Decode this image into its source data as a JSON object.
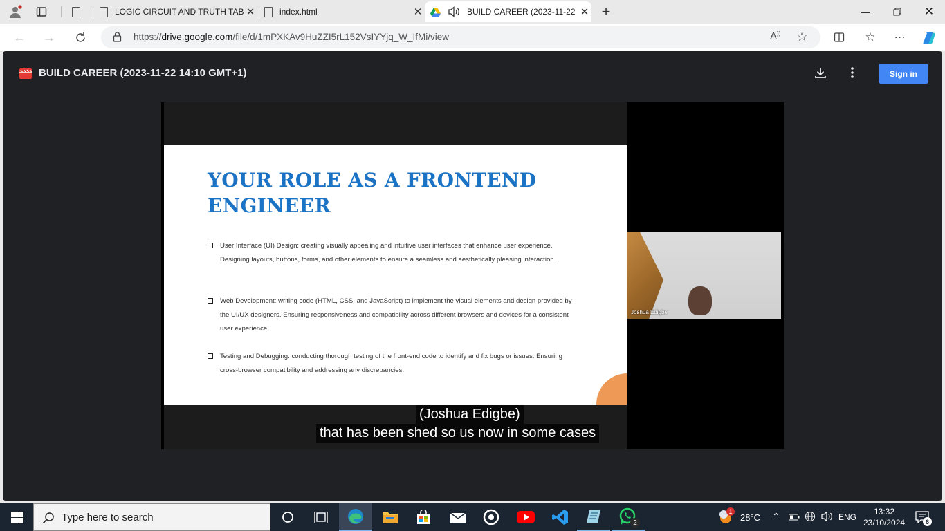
{
  "browser": {
    "tabs": [
      {
        "label": "LOGIC CIRCUIT AND TRUTH TABL"
      },
      {
        "label": "index.html"
      },
      {
        "label": "BUILD CAREER (2023-11-22"
      }
    ],
    "url_prefix": "https://",
    "url_domain": "drive.google.com",
    "url_path": "/file/d/1mPXKAv9HuZZI5rL152VsIYYjq_W_IfMi/view"
  },
  "viewer": {
    "title": "BUILD CAREER (2023-11-22 14:10 GMT+1)",
    "sign_in_label": "Sign in"
  },
  "slide": {
    "title": "YOUR ROLE AS A FRONTEND ENGINEER",
    "bullets": [
      {
        "text": "User Interface (UI) Design: creating visually appealing and intuitive user interfaces that enhance user experience. Designing layouts, buttons, forms, and other elements to ensure a seamless and aesthetically pleasing interaction."
      },
      {
        "text": "Web Development: writing code (HTML, CSS, and JavaScript) to implement the visual elements and design provided by the UI/UX designers. Ensuring responsiveness and compatibility across different browsers and devices for a consistent user experience."
      },
      {
        "text": "Testing and Debugging: conducting thorough testing of the front-end code to identify and fix bugs or issues. Ensuring cross-browser compatibility and addressing any discrepancies."
      }
    ]
  },
  "webcam": {
    "name": "Joshua Edigbe"
  },
  "captions": {
    "speaker": "(Joshua Edigbe)",
    "line": "that has been shed so us now in some cases"
  },
  "taskbar": {
    "search_placeholder": "Type here to search",
    "weather_temp": "28°C",
    "weather_badge": "1",
    "language": "ENG",
    "time": "13:32",
    "date": "23/10/2024",
    "notification_count": "6",
    "whatsapp_badge": "2"
  },
  "colors": {
    "accent_blue": "#4285f4",
    "slide_title_blue": "#1a73c4",
    "viewer_bg": "#202124"
  }
}
